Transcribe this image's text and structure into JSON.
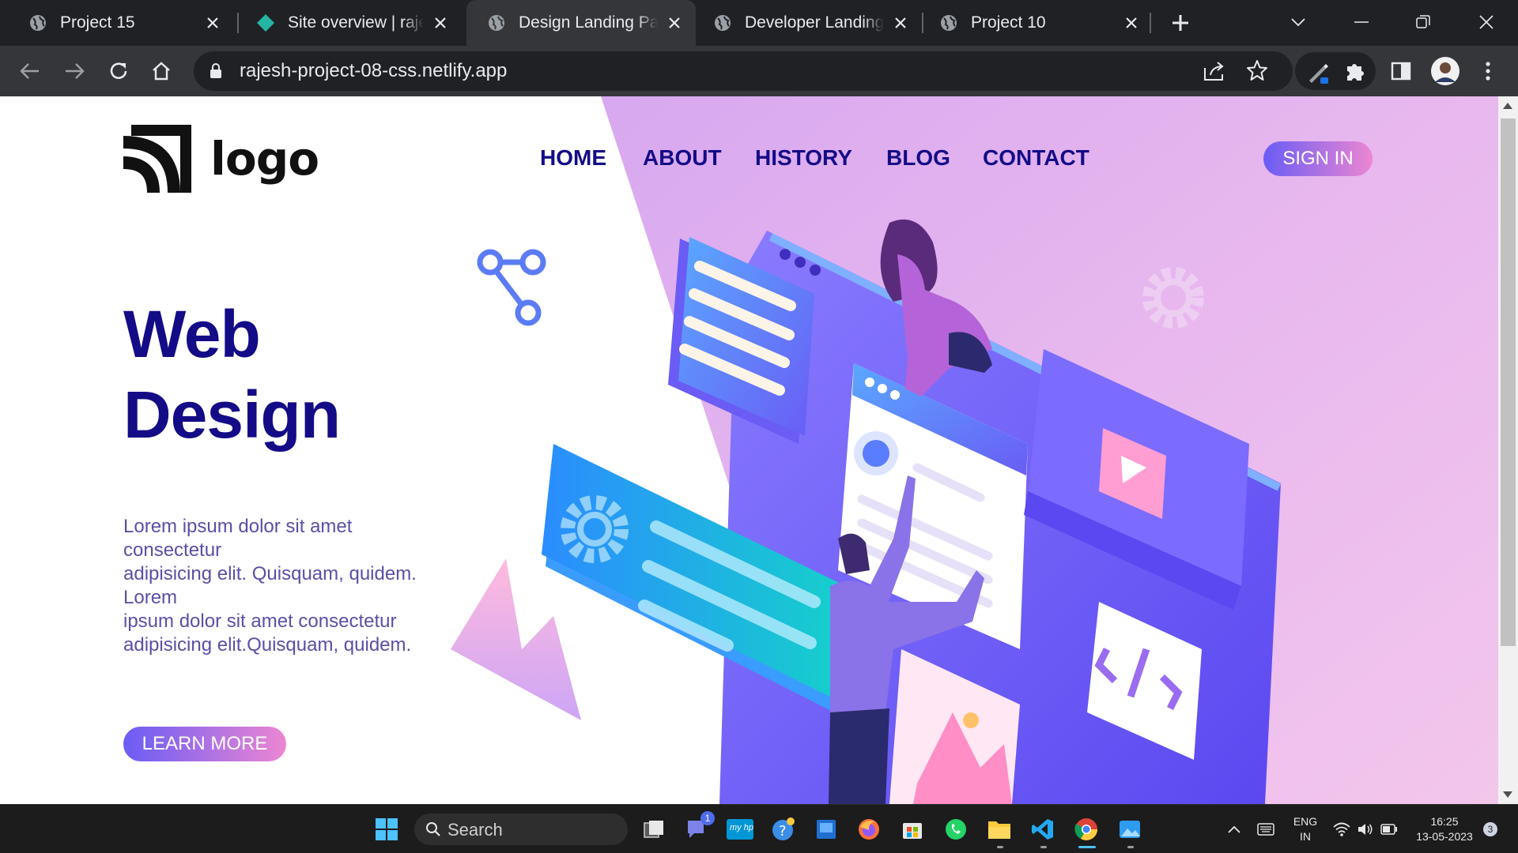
{
  "browser": {
    "tabs": [
      {
        "title": "Project 15",
        "favicon": "globe-icon"
      },
      {
        "title": "Site overview | rajesh",
        "favicon": "netlify-diamond-icon"
      },
      {
        "title": "Design Landing Page",
        "favicon": "globe-icon",
        "active": true
      },
      {
        "title": "Developer Landing",
        "favicon": "globe-icon"
      },
      {
        "title": "Project 10",
        "favicon": "globe-icon"
      }
    ],
    "url": "rajesh-project-08-css.netlify.app"
  },
  "site": {
    "logo_text": "logo",
    "nav": {
      "home": "HOME",
      "about": "ABOUT",
      "history": "HISTORY",
      "blog": "BLOG",
      "contact": "CONTACT"
    },
    "signin_label": "SIGN IN",
    "hero": {
      "title_line1": "Web",
      "title_line2": "Design",
      "text_lines": [
        "Lorem ipsum dolor sit amet",
        "consectetur",
        "adipisicing elit. Quisquam, quidem.",
        "Lorem",
        "ipsum dolor sit amet consectetur",
        "adipisicing elit.Quisquam, quidem."
      ],
      "cta_label": "LEARN MORE"
    },
    "colors": {
      "heading": "#140b87",
      "body_text": "#5a4fa6",
      "gradient_start": "#6a5cf5",
      "gradient_end": "#ec86d2"
    }
  },
  "taskbar": {
    "search_label": "Search",
    "teams_badge": "1",
    "mylife_label": "my hp",
    "language_line1": "ENG",
    "language_line2": "IN",
    "time": "16:25",
    "date": "13-05-2023",
    "notification_count": "3"
  }
}
